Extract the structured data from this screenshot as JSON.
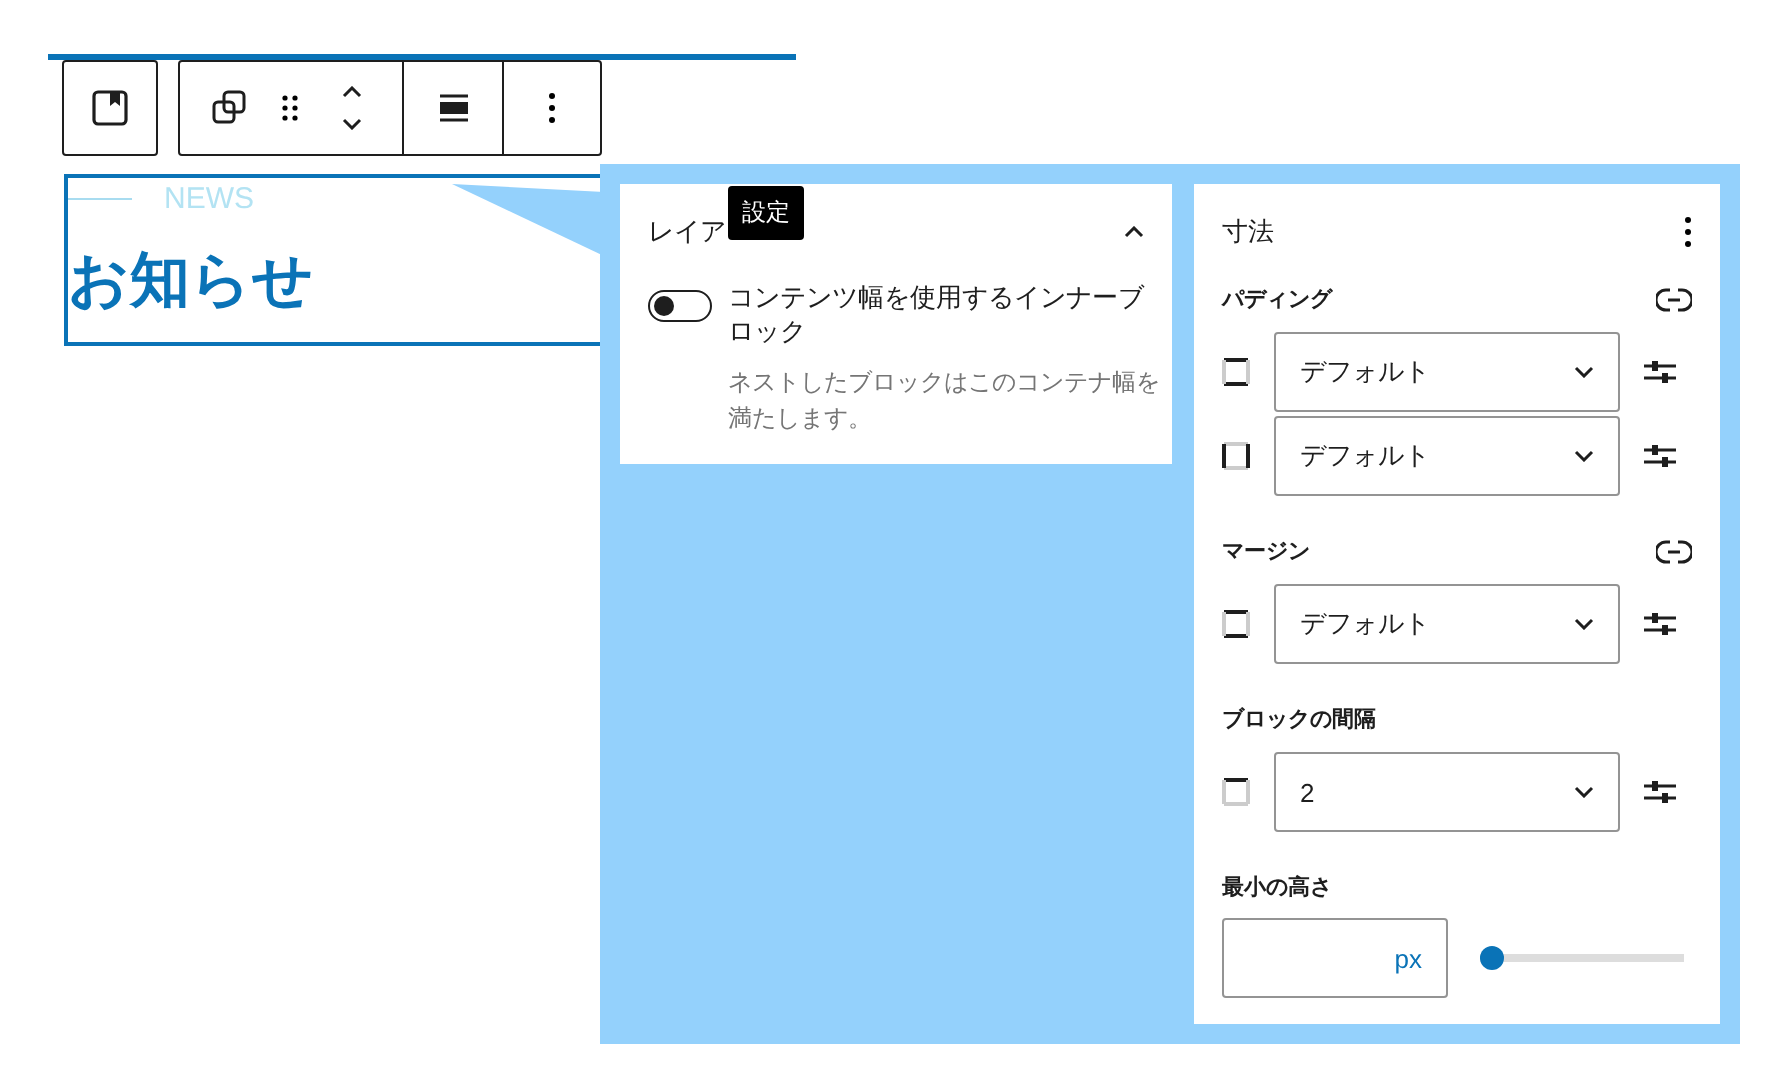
{
  "block": {
    "eyebrow": "NEWS",
    "heading": "お知らせ"
  },
  "tooltip": "設定",
  "layout_panel": {
    "title": "レイア",
    "expanded": true,
    "toggle": {
      "label": "コンテンツ幅を使用するインナーブロック",
      "on": false
    },
    "help": "ネストしたブロックはこのコンテナ幅を満たします。"
  },
  "dimensions": {
    "title": "寸法",
    "sections": [
      {
        "label": "パディング",
        "linked": true,
        "rows": [
          {
            "kind": "vertical",
            "value": "デフォルト"
          },
          {
            "kind": "horizontal",
            "value": "デフォルト"
          }
        ]
      },
      {
        "label": "マージン",
        "linked": true,
        "rows": [
          {
            "kind": "vertical",
            "value": "デフォルト"
          }
        ]
      },
      {
        "label": "ブロックの間隔",
        "rows": [
          {
            "kind": "top",
            "value": "2"
          }
        ]
      }
    ],
    "min_height": {
      "label": "最小の高さ",
      "unit": "px",
      "level": 0
    }
  }
}
